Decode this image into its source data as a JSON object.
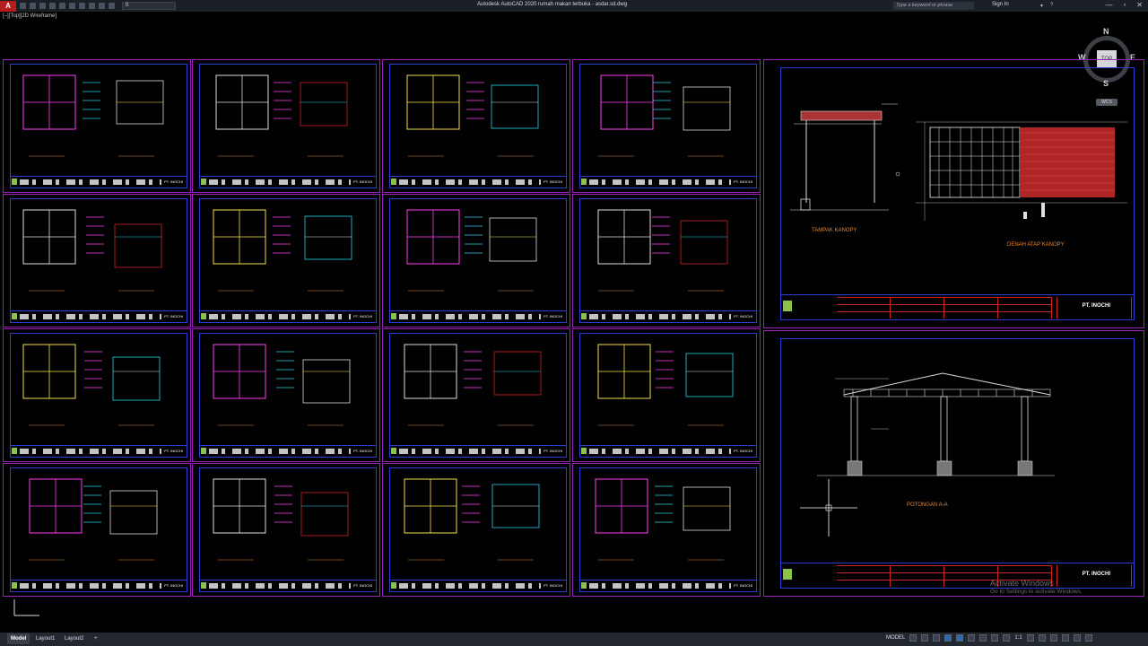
{
  "titlebar": {
    "app_letter": "A",
    "layer_value": "0",
    "title": "Autodesk AutoCAD 2020   rumah makan terbuka - asdar.sd.dwg",
    "search_placeholder": "Type a keyword or phrase",
    "signin_label": "Sign In",
    "min_label": "—",
    "max_label": "▫",
    "close_label": "✕"
  },
  "viewport_label": "[–][Top][2D Wireframe]",
  "viewcube": {
    "north": "N",
    "south": "S",
    "east": "E",
    "west": "W",
    "face": "TOP",
    "wcs": "WCS"
  },
  "sheets": {
    "company": "PT. INOCHI",
    "big_top": {
      "caption_left": "TAMPAK KANOPY",
      "caption_right": "DENAH ATAP KANOPY"
    },
    "big_bottom": {
      "caption": "POTONGAN A-A"
    }
  },
  "statusbar": {
    "tabs": [
      "Model",
      "Layout1",
      "Layout2"
    ],
    "add_tab": "+",
    "model_label": "MODEL",
    "scale_label": "1:1"
  },
  "watermark": {
    "line1": "Activate Windows",
    "line2": "Go to Settings to activate Windows."
  },
  "colors": {
    "sheet_border": "#9a22b8",
    "frame": "#2b3fd6",
    "accent_red": "#c22",
    "cyan": "#2ad1e6",
    "magenta": "#ff3cf0",
    "yellow": "#f5e04a"
  }
}
